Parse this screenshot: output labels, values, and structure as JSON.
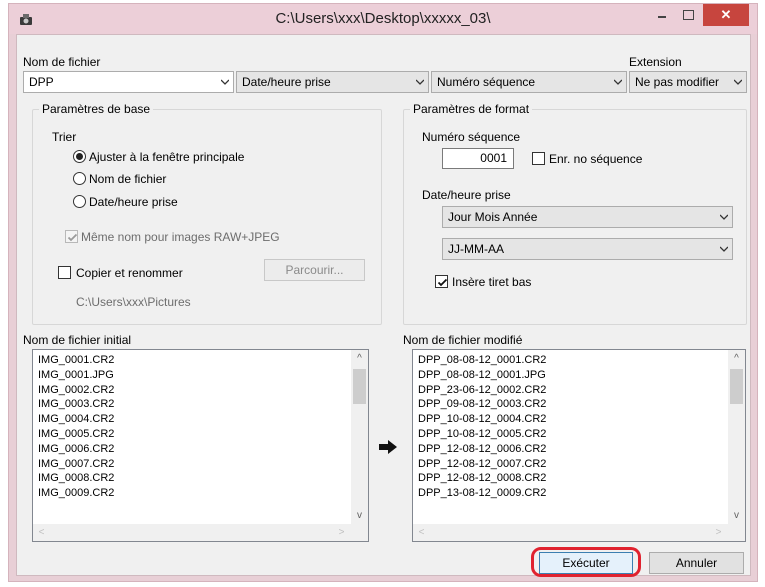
{
  "window": {
    "title": "C:\\Users\\xxx\\Desktop\\xxxxx_03\\",
    "close_glyph": "✕"
  },
  "filename": {
    "label": "Nom de fichier",
    "part1": "DPP",
    "part2": "Date/heure prise",
    "part3": "Numéro séquence"
  },
  "extension": {
    "label": "Extension",
    "value": "Ne pas modifier"
  },
  "basic": {
    "title": "Paramètres de base",
    "sort_label": "Trier",
    "sort_options": [
      "Ajuster à la fenêtre principale",
      "Nom de fichier",
      "Date/heure prise"
    ],
    "sort_selected": 0,
    "same_name_label": "Même nom pour images RAW+JPEG",
    "copy_label": "Copier et renommer",
    "browse_label": "Parcourir...",
    "path": "C:\\Users\\xxx\\Pictures"
  },
  "format": {
    "title": "Paramètres de format",
    "seq_label": "Numéro séquence",
    "seq_value": "0001",
    "save_seq_label": "Enr. no séquence",
    "date_label": "Date/heure prise",
    "date_order": "Jour Mois Année",
    "date_format": "JJ-MM-AA",
    "underscore_label": "Insère tiret bas"
  },
  "initial": {
    "label": "Nom de fichier initial",
    "files": [
      "IMG_0001.CR2",
      "IMG_0001.JPG",
      "IMG_0002.CR2",
      "IMG_0003.CR2",
      "IMG_0004.CR2",
      "IMG_0005.CR2",
      "IMG_0006.CR2",
      "IMG_0007.CR2",
      "IMG_0008.CR2",
      "IMG_0009.CR2"
    ]
  },
  "modified": {
    "label": "Nom de fichier modifié",
    "files": [
      "DPP_08-08-12_0001.CR2",
      "DPP_08-08-12_0001.JPG",
      "DPP_23-06-12_0002.CR2",
      "DPP_09-08-12_0003.CR2",
      "DPP_10-08-12_0004.CR2",
      "DPP_10-08-12_0005.CR2",
      "DPP_12-08-12_0006.CR2",
      "DPP_12-08-12_0007.CR2",
      "DPP_12-08-12_0008.CR2",
      "DPP_13-08-12_0009.CR2"
    ]
  },
  "buttons": {
    "execute": "Exécuter",
    "cancel": "Annuler"
  },
  "colors": {
    "highlight": "#e0222f",
    "close": "#c7453e"
  }
}
